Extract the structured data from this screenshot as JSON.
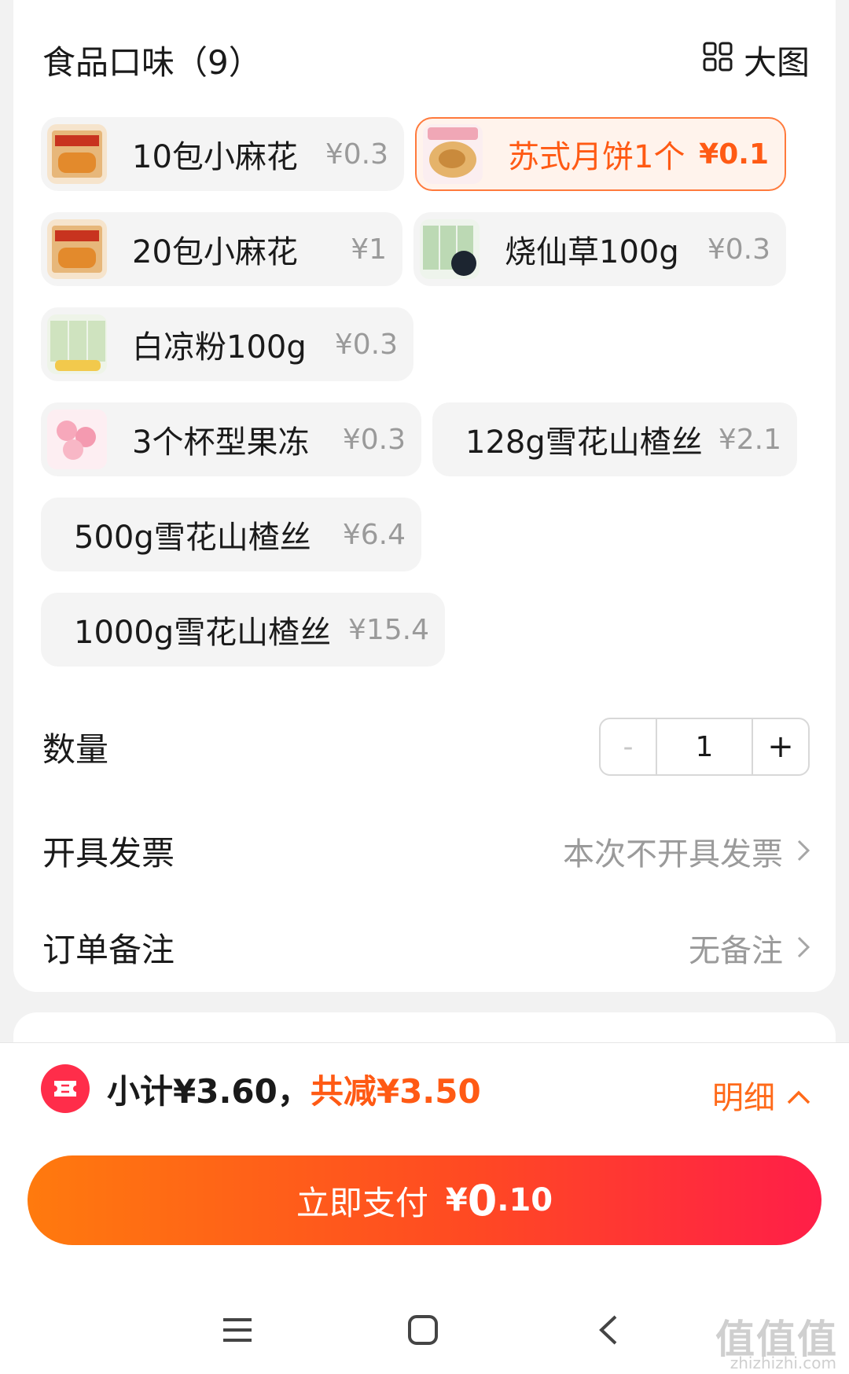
{
  "section": {
    "title": "食品口味（9）",
    "bigview_label": "大图"
  },
  "options": [
    {
      "name": "10包小麻花",
      "price": "¥0.3",
      "image": "mahua-box",
      "selected": false
    },
    {
      "name": "苏式月饼1个",
      "price": "¥0.1",
      "image": "mooncake",
      "selected": true
    },
    {
      "name": "20包小麻花",
      "price": "¥1",
      "image": "mahua-box",
      "selected": false
    },
    {
      "name": "烧仙草100g",
      "price": "¥0.3",
      "image": "grass-jelly",
      "selected": false
    },
    {
      "name": "白凉粉100g",
      "price": "¥0.3",
      "image": "white-jelly",
      "selected": false
    },
    {
      "name": "3个杯型果冻",
      "price": "¥0.3",
      "image": "cup-jelly",
      "selected": false
    },
    {
      "name": "128g雪花山楂丝",
      "price": "¥2.1",
      "image": "",
      "selected": false
    },
    {
      "name": "500g雪花山楂丝",
      "price": "¥6.4",
      "image": "",
      "selected": false
    },
    {
      "name": "1000g雪花山楂丝",
      "price": "¥15.4",
      "image": "",
      "selected": false
    }
  ],
  "quantity": {
    "label": "数量",
    "minus": "-",
    "value": "1",
    "plus": "+"
  },
  "invoice": {
    "label": "开具发票",
    "value": "本次不开具发票"
  },
  "remark": {
    "label": "订单备注",
    "value": "无备注"
  },
  "summary": {
    "subtotal": "小计¥3.60，",
    "reduced": "共减¥3.50",
    "detail_label": "明细"
  },
  "pay": {
    "label": "立即支付",
    "currency": "¥",
    "amount_int": "0",
    "amount_dec": ".10"
  },
  "watermark": {
    "text": "值值值",
    "sub": "zhizhizhi.com"
  },
  "colors": {
    "accent": "#ff5a14",
    "pay_gradient_start": "#ff7a0e",
    "pay_gradient_end": "#ff1e48",
    "coupon": "#ff2d4a"
  }
}
